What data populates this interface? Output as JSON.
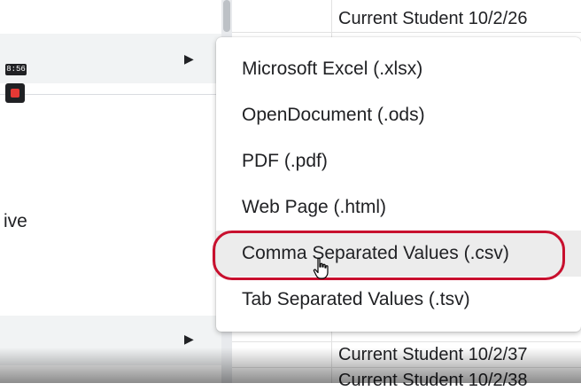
{
  "background": {
    "timer_text": "8:56",
    "side_text": "ive",
    "sheet_rows": [
      "Current Student 10/2/26",
      "Current Student 10/2/37",
      "Current Student 10/2/38"
    ]
  },
  "submenu": {
    "items": [
      {
        "label": "Microsoft Excel (.xlsx)"
      },
      {
        "label": "OpenDocument (.ods)"
      },
      {
        "label": "PDF (.pdf)"
      },
      {
        "label": "Web Page (.html)"
      },
      {
        "label": "Comma Separated Values (.csv)",
        "hovered": true
      },
      {
        "label": "Tab Separated Values (.tsv)"
      }
    ]
  },
  "colors": {
    "highlight_ring": "#c8102e",
    "record_button": "#e53935"
  },
  "icons": {
    "submenu_arrow": "triangle-right-icon",
    "cursor": "hand-pointer-icon",
    "record": "record-stop-icon"
  }
}
